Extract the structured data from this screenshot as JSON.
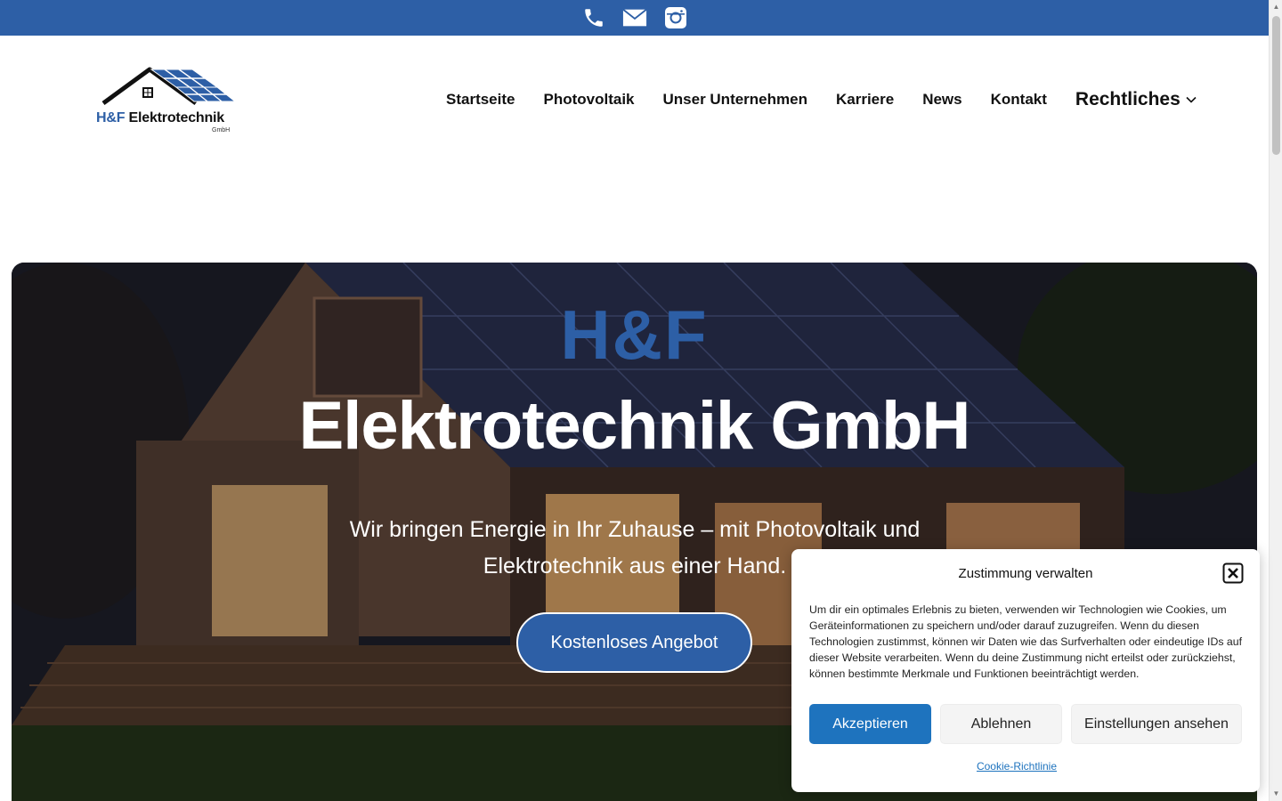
{
  "topbar": {
    "icons": [
      "phone-icon",
      "mail-icon",
      "instagram-icon"
    ],
    "color": "#2d5fa6"
  },
  "header": {
    "logo": {
      "brand": "H&F",
      "name": "Elektrotechnik",
      "sub": "GmbH"
    },
    "nav": [
      {
        "label": "Startseite"
      },
      {
        "label": "Photovoltaik"
      },
      {
        "label": "Unser Unternehmen"
      },
      {
        "label": "Karriere"
      },
      {
        "label": "News"
      },
      {
        "label": "Kontakt"
      },
      {
        "label": "Rechtliches"
      }
    ]
  },
  "hero": {
    "brand": "H&F",
    "title": "Elektrotechnik GmbH",
    "subtitle": "Wir bringen Energie in Ihr Zuhause – mit Photovoltaik und Elektrotechnik aus einer Hand.",
    "cta": "Kostenloses Angebot"
  },
  "cookie": {
    "title": "Zustimmung verwalten",
    "body": "Um dir ein optimales Erlebnis zu bieten, verwenden wir Technologien wie Cookies, um Geräteinformationen zu speichern und/oder darauf zuzugreifen. Wenn du diesen Technologien zustimmst, können wir Daten wie das Surfverhalten oder eindeutige IDs auf dieser Website verarbeiten. Wenn du deine Zustimmung nicht erteilst oder zurückziehst, können bestimmte Merkmale und Funktionen beeinträchtigt werden.",
    "accept": "Akzeptieren",
    "deny": "Ablehnen",
    "settings": "Einstellungen ansehen",
    "policy_link": "Cookie-Richtlinie"
  },
  "colors": {
    "brand_blue": "#2d5fa6",
    "accept_blue": "#1e73be"
  }
}
